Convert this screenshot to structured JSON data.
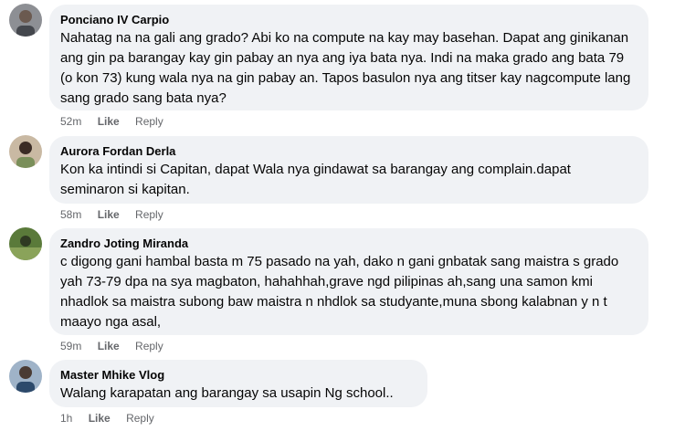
{
  "comments": [
    {
      "author": "Ponciano IV Carpio",
      "text": "Nahatag na na gali ang grado? Abi ko na compute na kay may basehan. Dapat ang ginikanan ang gin pa barangay kay gin pabay an nya ang iya bata nya. Indi na maka grado ang bata 79 (o kon 73) kung wala nya na gin pabay an. Tapos basulon nya ang titser kay nagcompute lang sang grado sang bata nya?",
      "time": "52m",
      "like": "Like",
      "reply": "Reply"
    },
    {
      "author": "Aurora Fordan Derla",
      "text": "Kon ka intindi si Capitan, dapat Wala nya gindawat sa barangay ang complain.dapat seminaron si kapitan.",
      "time": "58m",
      "like": "Like",
      "reply": "Reply"
    },
    {
      "author": "Zandro Joting Miranda",
      "text": "c digong gani hambal basta m 75 pasado na yah, dako n gani gnbatak sang maistra s grado yah 73-79 dpa na sya magbaton, hahahhah,grave ngd pilipinas ah,sang una samon kmi nhadlok sa maistra subong baw maistra n nhdlok sa studyante,muna sbong kalabnan y n t maayo nga asal,",
      "time": "59m",
      "like": "Like",
      "reply": "Reply"
    },
    {
      "author": "Master Mhike Vlog",
      "text": "Walang karapatan ang barangay sa usapin Ng school..",
      "time": "1h",
      "like": "Like",
      "reply": "Reply"
    }
  ],
  "colors": {
    "bubble_bg": "#f0f2f5",
    "text": "#050505",
    "meta": "#65676b"
  }
}
